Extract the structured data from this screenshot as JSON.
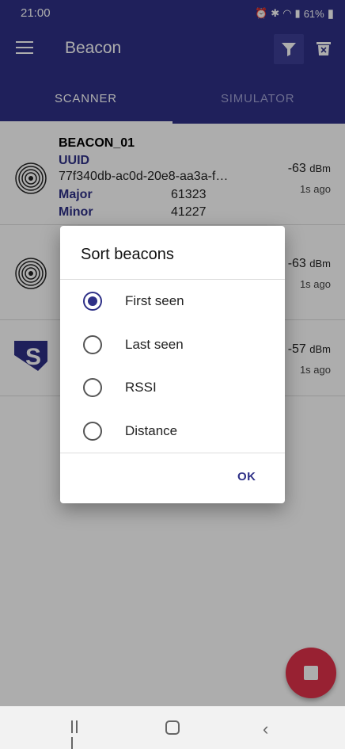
{
  "status_bar": {
    "time": "21:00",
    "battery": "61%",
    "icons": [
      "alarm-icon",
      "bluetooth-icon",
      "wifi-icon",
      "volte-icon",
      "signal-icon",
      "battery-icon"
    ]
  },
  "app_bar": {
    "title": "Beacon"
  },
  "tabs": [
    {
      "label": "SCANNER",
      "active": true
    },
    {
      "label": "SIMULATOR",
      "active": false
    }
  ],
  "beacons": [
    {
      "name": "BEACON_01",
      "uuid_label": "UUID",
      "uuid": "77f340db-ac0d-20e8-aa3a-f…",
      "major_label": "Major",
      "major": "61323",
      "minor_label": "Minor",
      "minor": "41227",
      "rssi": "-63",
      "rssi_unit": "dBm",
      "ago": "1s ago"
    },
    {
      "rssi": "-63",
      "rssi_unit": "dBm",
      "ago": "1s ago"
    },
    {
      "rssi": "-57",
      "rssi_unit": "dBm",
      "ago": "1s ago"
    }
  ],
  "dialog": {
    "title": "Sort beacons",
    "options": [
      {
        "label": "First seen",
        "selected": true
      },
      {
        "label": "Last seen",
        "selected": false
      },
      {
        "label": "RSSI",
        "selected": false
      },
      {
        "label": "Distance",
        "selected": false
      }
    ],
    "ok_label": "OK"
  },
  "colors": {
    "primary": "#2e3087",
    "fab": "#e0324b"
  }
}
